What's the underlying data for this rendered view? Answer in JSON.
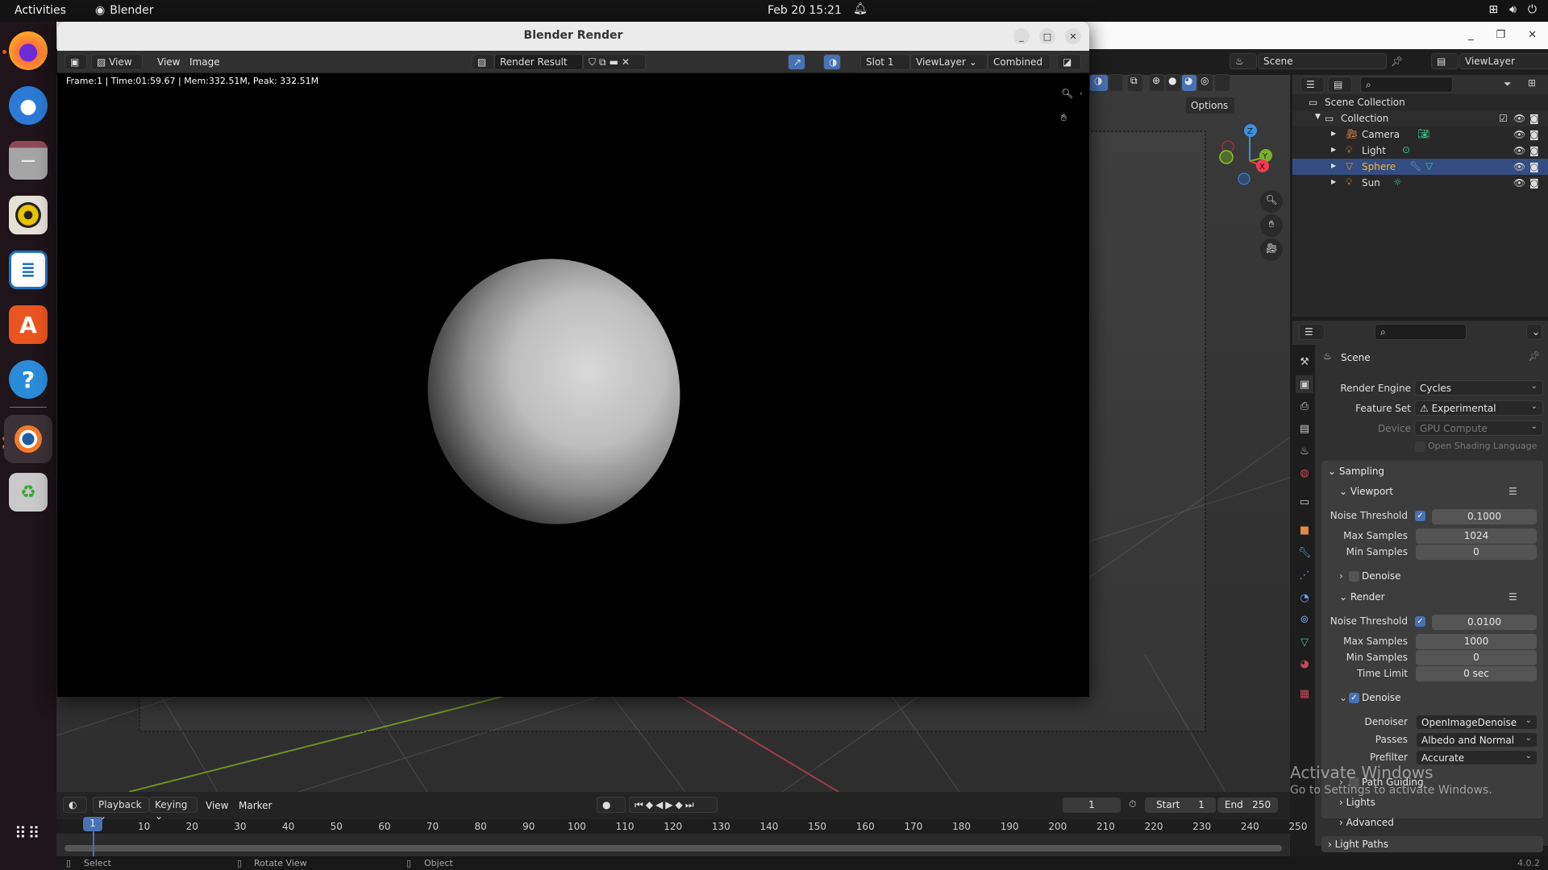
{
  "system": {
    "activities": "Activities",
    "app_name": "Blender",
    "datetime": "Feb 20  15:21"
  },
  "dock": {
    "items": [
      {
        "name": "Firefox",
        "color": "#ff7139",
        "active": true
      },
      {
        "name": "Thunderbird",
        "color": "#2a7ad6"
      },
      {
        "name": "Files",
        "color": "#9a9a9a"
      },
      {
        "name": "Rhythmbox",
        "color": "#e9c200"
      },
      {
        "name": "LibreOffice Writer",
        "color": "#1e73be"
      },
      {
        "name": "App Center",
        "color": "#e95420"
      },
      {
        "name": "Help",
        "color": "#2a8bd8"
      },
      {
        "name": "Blender",
        "color": "#f5792a",
        "active": true
      },
      {
        "name": "Trash",
        "color": "#9d9d9d"
      }
    ],
    "show_apps": "⋮⋮⋮"
  },
  "render_window": {
    "title": "Blender Render",
    "header": {
      "editor_menu": "View",
      "menus": [
        "View",
        "Image"
      ],
      "image_name": "Render Result",
      "slot": "Slot 1",
      "view_layer": "ViewLayer",
      "pass": "Combined"
    },
    "metadata": "Frame:1 | Time:01:59.67 | Mem:332.51M, Peak: 332.51M"
  },
  "main_window": {
    "scene": "Scene",
    "view_layer": "ViewLayer",
    "viewport": {
      "options_label": "Options",
      "gizmo_axes": [
        "Z",
        "Y",
        "X"
      ]
    }
  },
  "outliner": {
    "root": "Scene Collection",
    "collection": "Collection",
    "items": [
      {
        "name": "Camera",
        "selected": false
      },
      {
        "name": "Light",
        "selected": false
      },
      {
        "name": "Sphere",
        "selected": true
      },
      {
        "name": "Sun",
        "selected": false
      }
    ]
  },
  "properties": {
    "context": "Scene",
    "render_engine_label": "Render Engine",
    "render_engine": "Cycles",
    "feature_set_label": "Feature Set",
    "feature_set": "Experimental",
    "device_label": "Device",
    "device": "GPU Compute",
    "osl_label": "Open Shading Language",
    "sampling": {
      "title": "Sampling",
      "viewport": {
        "title": "Viewport",
        "noise_threshold_label": "Noise Threshold",
        "noise_threshold": "0.1000",
        "max_samples_label": "Max Samples",
        "max_samples": "1024",
        "min_samples_label": "Min Samples",
        "min_samples": "0",
        "denoise_label": "Denoise"
      },
      "render": {
        "title": "Render",
        "noise_threshold_label": "Noise Threshold",
        "noise_threshold": "0.0100",
        "max_samples_label": "Max Samples",
        "max_samples": "1000",
        "min_samples_label": "Min Samples",
        "min_samples": "0",
        "time_limit_label": "Time Limit",
        "time_limit": "0 sec",
        "denoise_label": "Denoise",
        "denoiser_label": "Denoiser",
        "denoiser": "OpenImageDenoise",
        "passes_label": "Passes",
        "passes": "Albedo and Normal",
        "prefilter_label": "Prefilter",
        "prefilter": "Accurate"
      },
      "path_guiding": "Path Guiding",
      "lights": "Lights",
      "advanced": "Advanced"
    },
    "light_paths": "Light Paths"
  },
  "timeline": {
    "menus": [
      "Playback",
      "Keying",
      "View",
      "Marker"
    ],
    "current_frame": "1",
    "start_label": "Start",
    "start": "1",
    "end_label": "End",
    "end": "250",
    "ticks": [
      "10",
      "20",
      "30",
      "40",
      "50",
      "60",
      "70",
      "80",
      "90",
      "100",
      "110",
      "120",
      "130",
      "140",
      "150",
      "160",
      "170",
      "180",
      "190",
      "200",
      "210",
      "220",
      "230",
      "240",
      "250"
    ],
    "playhead": "1"
  },
  "statusbar": {
    "select": "Select",
    "rotate": "Rotate View",
    "object": "Object",
    "version": "4.0.2"
  },
  "watermark": {
    "line1": "Activate Windows",
    "line2": "Go to Settings to activate Windows."
  }
}
